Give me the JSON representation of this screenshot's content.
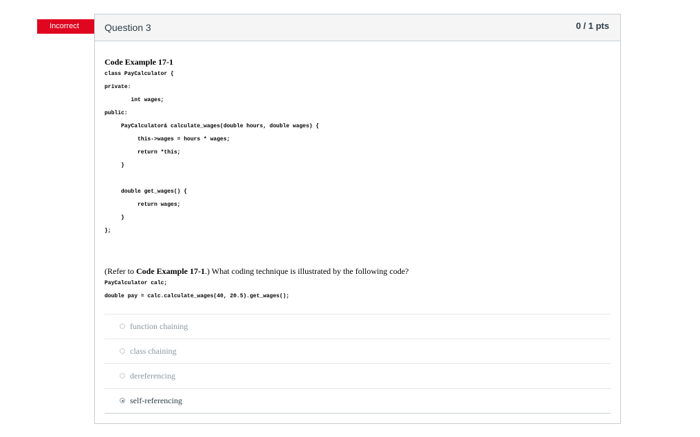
{
  "flag": {
    "label": "Incorrect",
    "color": "#e0061f"
  },
  "question": {
    "title": "Question 3",
    "points": "0 / 1 pts",
    "example_title": "Code Example 17-1",
    "code": [
      "class PayCalculator {",
      "private:",
      "        int wages;",
      "public:",
      "     PayCalculator& calculate_wages(double hours, double wages) {",
      "          this->wages = hours * wages;",
      "          return *this;",
      "     }",
      "",
      "     double get_wages() {",
      "          return wages;",
      "     }",
      "};"
    ],
    "prompt_prefix": "(Refer to ",
    "prompt_ref": "Code Example 17-1",
    "prompt_suffix": ".) What coding technique is illustrated by the following code?",
    "snippet": [
      "PayCalculator calc;",
      "double pay = calc.calculate_wages(40, 20.5).get_wages();"
    ],
    "answers": [
      {
        "label": "function chaining",
        "selected": false
      },
      {
        "label": "class chaining",
        "selected": false
      },
      {
        "label": "dereferencing",
        "selected": false
      },
      {
        "label": "self-referencing",
        "selected": true
      }
    ]
  }
}
